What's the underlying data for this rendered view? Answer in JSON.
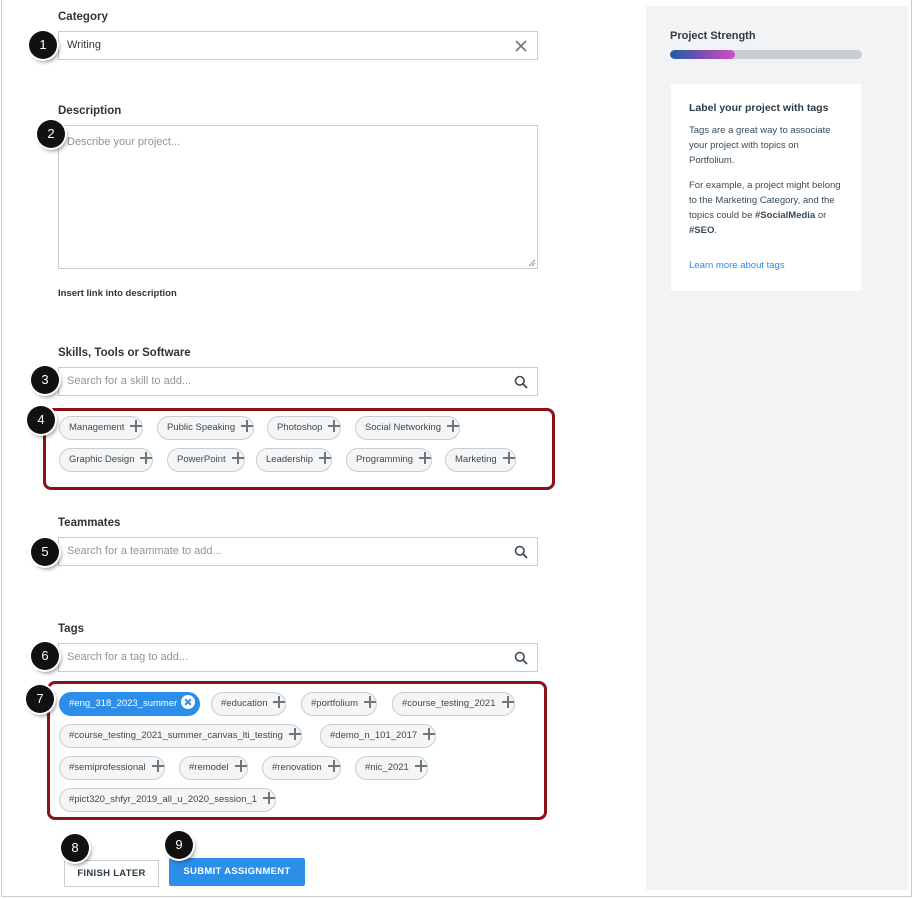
{
  "form": {
    "category_label": "Category",
    "category_value": "Writing",
    "description_label": "Description",
    "description_placeholder": "Describe your project...",
    "insert_link": "Insert link into description",
    "skills_label": "Skills, Tools or Software",
    "skills_placeholder": "Search for a skill to add...",
    "skills": [
      "Management",
      "Public Speaking",
      "Photoshop",
      "Social Networking",
      "Graphic Design",
      "PowerPoint",
      "Leadership",
      "Programming",
      "Marketing"
    ],
    "teammates_label": "Teammates",
    "teammates_placeholder": "Search for a teammate to add...",
    "tags_label": "Tags",
    "tags_placeholder": "Search for a tag to add...",
    "selected_tag": "#eng_318_2023_summer",
    "tags": [
      "#education",
      "#portfolium",
      "#course_testing_2021",
      "#course_testing_2021_summer_canvas_lti_testing",
      "#demo_n_101_2017",
      "#semiprofessional",
      "#remodel",
      "#renovation",
      "#nic_2021",
      "#pict320_shfyr_2019_all_u_2020_session_1"
    ]
  },
  "buttons": {
    "finish_later": "FINISH LATER",
    "submit": "SUBMIT ASSIGNMENT"
  },
  "badges": [
    "1",
    "2",
    "3",
    "4",
    "5",
    "6",
    "7",
    "8",
    "9"
  ],
  "sidebar": {
    "strength_title": "Project Strength",
    "strength_fraction": 0.34,
    "card_title": "Label your project with tags",
    "card_p1": "Tags are a great way to associate your project with topics on Portfolium.",
    "card_p2_a": "For example, a project might belong to the Marketing Category, and the topics could be ",
    "card_p2_b": "#SocialMedia",
    "card_p2_c": " or ",
    "card_p2_d": "#SEO",
    "card_p2_e": ".",
    "learn_more": "Learn more about tags"
  },
  "colors": {
    "accent": "#2b8ee8",
    "annotation_box": "#8b1216",
    "badge": "#111111"
  }
}
